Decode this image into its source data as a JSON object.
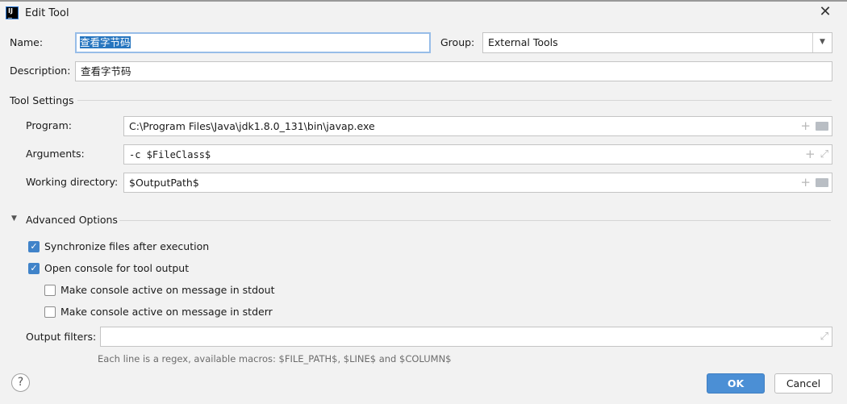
{
  "window": {
    "title": "Edit Tool",
    "close_icon": "close-icon",
    "logo": "IJ"
  },
  "name": {
    "label": "Name:",
    "value": "查看字节码"
  },
  "group": {
    "label": "Group:",
    "value": "External Tools"
  },
  "description": {
    "label": "Description:",
    "value": "查看字节码"
  },
  "tool_settings": {
    "title": "Tool Settings",
    "program": {
      "label": "Program:",
      "value": "C:\\Program Files\\Java\\jdk1.8.0_131\\bin\\javap.exe"
    },
    "arguments": {
      "label": "Arguments:",
      "value": "-c $FileClass$"
    },
    "working_directory": {
      "label": "Working directory:",
      "value": "$OutputPath$"
    }
  },
  "advanced": {
    "title": "Advanced Options",
    "options": [
      {
        "label": "Synchronize files after execution",
        "checked": true
      },
      {
        "label": "Open console for tool output",
        "checked": true
      },
      {
        "label": "Make console active on message in stdout",
        "checked": false
      },
      {
        "label": "Make console active on message in stderr",
        "checked": false
      }
    ],
    "output_filters": {
      "label": "Output filters:",
      "value": ""
    },
    "hint": "Each line is a regex, available macros: $FILE_PATH$, $LINE$ and $COLUMN$"
  },
  "buttons": {
    "ok": "OK",
    "cancel": "Cancel",
    "help": "?"
  },
  "colors": {
    "accent": "#4b8fd5",
    "selection": "#2675bf"
  }
}
